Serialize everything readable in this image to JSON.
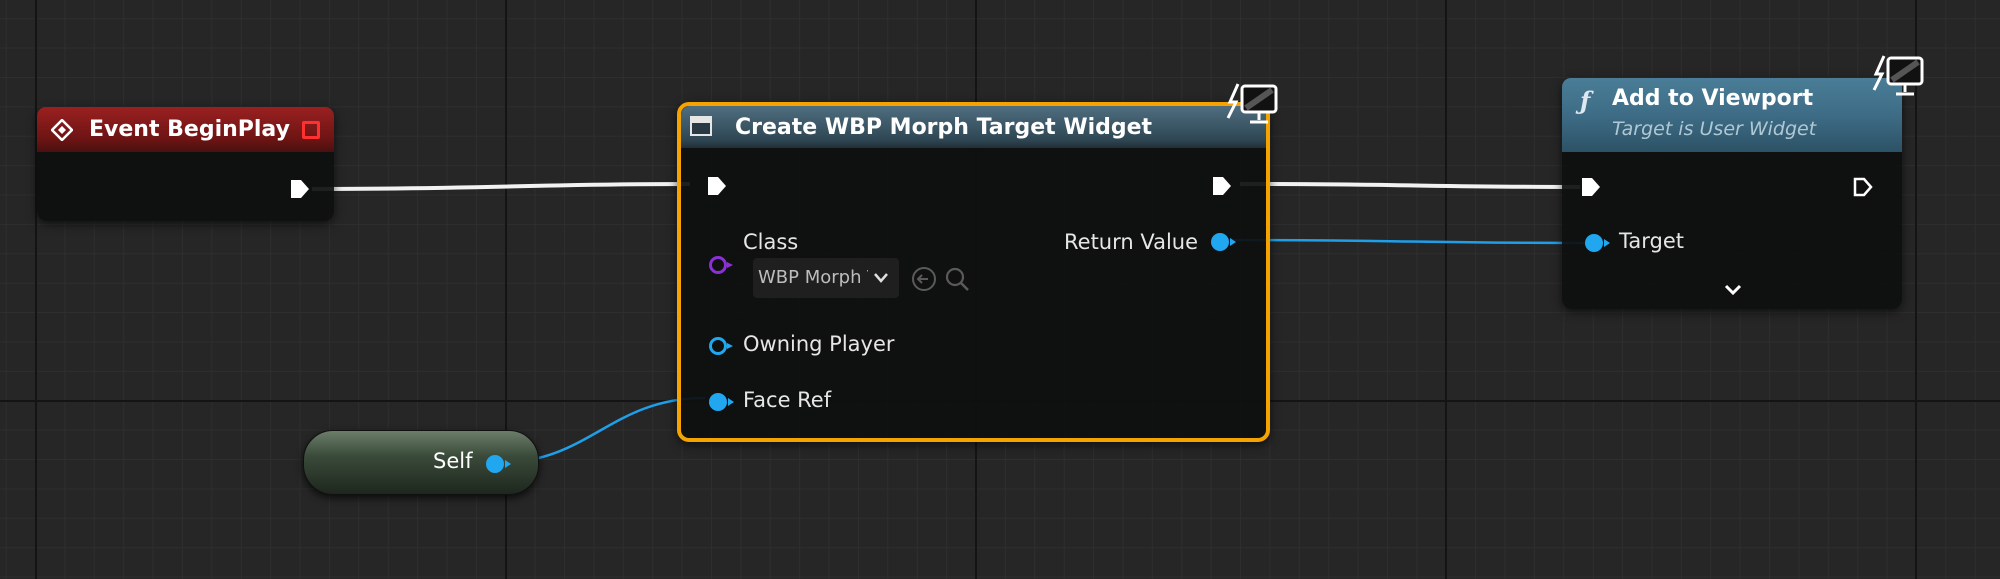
{
  "nodes": {
    "begin_play": {
      "title": "Event BeginPlay"
    },
    "create_widget": {
      "title": "Create WBP Morph Target Widget",
      "pins": {
        "class": "Class",
        "class_value": "WBP Morph Targ",
        "return_value": "Return Value",
        "owning_player": "Owning Player",
        "face_ref": "Face Ref"
      }
    },
    "add_to_viewport": {
      "title": "Add to Viewport",
      "subtitle": "Target is User Widget",
      "pins": {
        "target": "Target"
      }
    },
    "self": {
      "label": "Self"
    }
  },
  "colors": {
    "event_header": "#8a1919",
    "function_header": "#3e6c86",
    "selection": "#f5a300",
    "object_pin": "#21a6f0",
    "class_pin": "#8b2fd6",
    "exec_pin": "#ffffff"
  },
  "icons": [
    "event-diamond-icon",
    "stop-square-icon",
    "widget-icon",
    "function-icon",
    "monitor-icon",
    "chevron-down-icon",
    "arrow-back-icon",
    "search-icon"
  ]
}
